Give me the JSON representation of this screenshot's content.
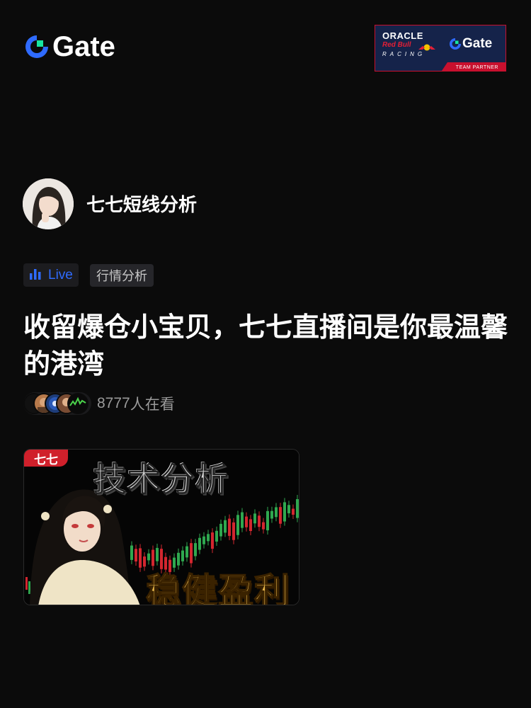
{
  "header": {
    "logo_text": "Gate",
    "partner": {
      "oracle": "ORACLE",
      "redbull": "Red Bull",
      "racing": "RACING",
      "gate": "Gate",
      "team": "TEAM PARTNER"
    }
  },
  "host": {
    "name": "七七短线分析"
  },
  "tags": {
    "live": "Live",
    "category": "行情分析"
  },
  "stream": {
    "title": "收留爆仓小宝贝，七七直播间是你最温馨的港湾",
    "viewer_count": "8777",
    "viewer_suffix": "人在看"
  },
  "thumbnail": {
    "badge": "七七",
    "top_text": "技术分析",
    "bottom_text": "稳健盈利"
  },
  "colors": {
    "background": "#0b0b0b",
    "brand_blue": "#2f6bff",
    "brand_green": "#17e6a1",
    "live_blue": "#2f6bff",
    "partner_navy": "#15234a",
    "partner_red": "#c8102e"
  },
  "icons": {
    "logo": "gate-logo-icon",
    "live": "live-bars-icon"
  }
}
